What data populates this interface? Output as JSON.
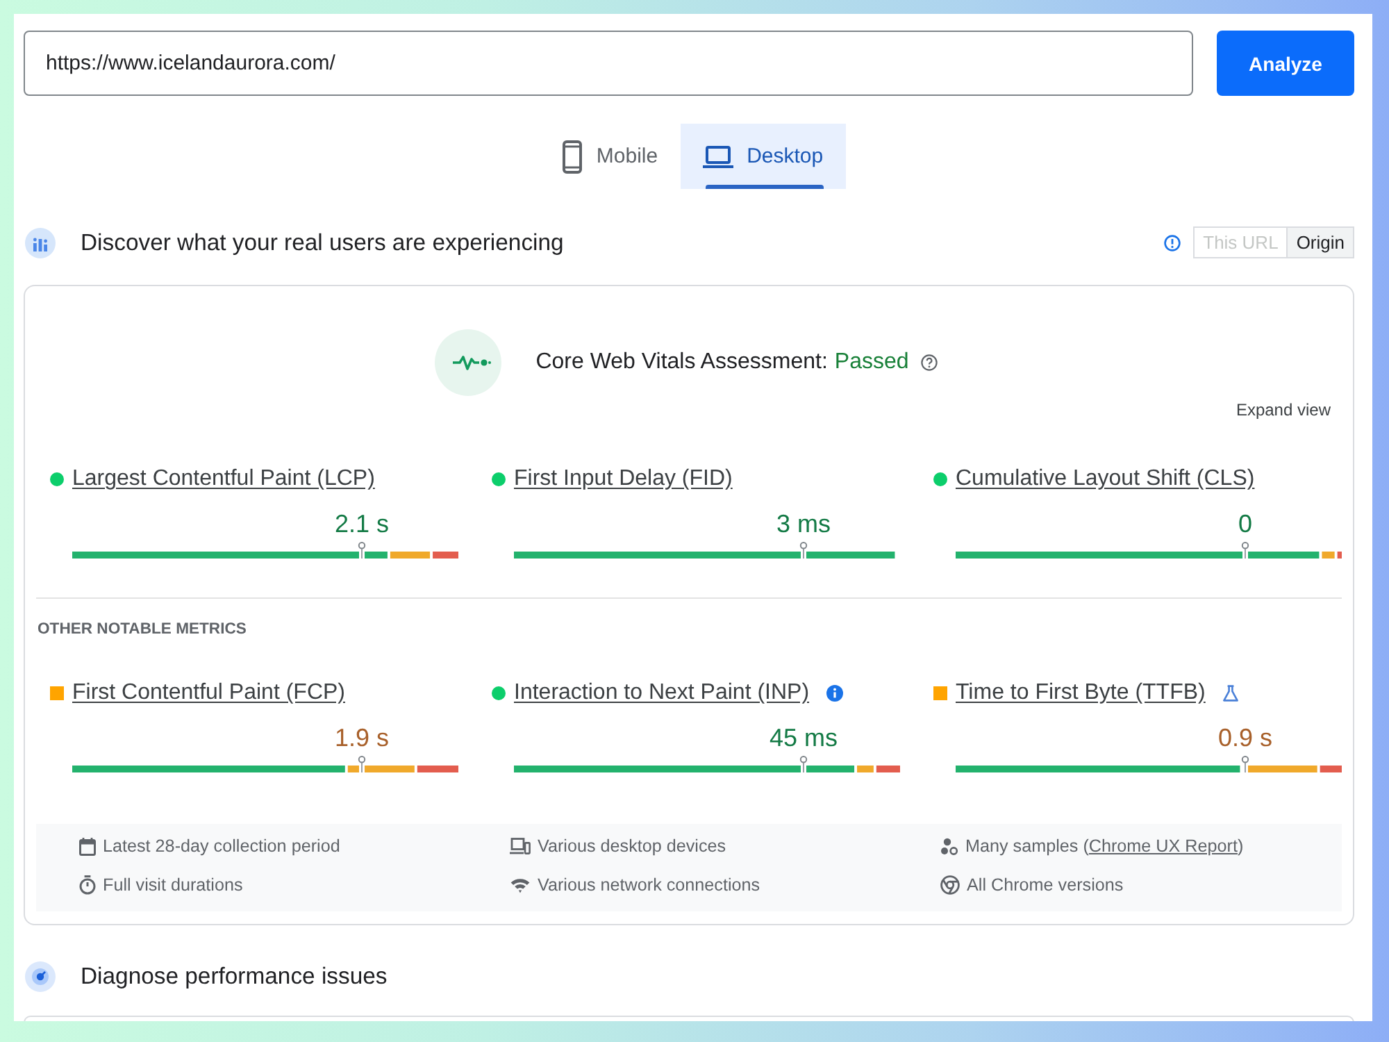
{
  "url_bar": {
    "value": "https://www.icelandaurora.com/",
    "button": "Analyze"
  },
  "device_tabs": [
    {
      "kind": "phone",
      "label": "Mobile",
      "selected": false
    },
    {
      "kind": "laptop",
      "label": "Desktop",
      "selected": true
    }
  ],
  "field_data": {
    "title": "Discover what your real users are experiencing",
    "scope_options": [
      {
        "label": "This URL",
        "selected": false,
        "disabled": true
      },
      {
        "label": "Origin",
        "selected": true,
        "disabled": false
      }
    ]
  },
  "assessment": {
    "label": "Core Web Vitals Assessment:",
    "result": "Passed",
    "passed": true,
    "expand_link": "Expand view"
  },
  "core_metrics": [
    {
      "name": "Largest Contentful Paint (LCP)",
      "value": "2.1 s",
      "kind": "good",
      "color": "#0cce6b",
      "info": false,
      "experimental": false
    },
    {
      "name": "First Input Delay (FID)",
      "value": "3 ms",
      "kind": "good",
      "color": "#0cce6b",
      "info": false,
      "experimental": false
    },
    {
      "name": "Cumulative Layout Shift (CLS)",
      "value": "0",
      "kind": "good",
      "color": "#0cce6b",
      "info": false,
      "experimental": false
    }
  ],
  "other_metrics_heading": "OTHER NOTABLE METRICS",
  "other_metrics": [
    {
      "name": "First Contentful Paint (FCP)",
      "value": "1.9 s",
      "kind": "average",
      "color": "#ffa400",
      "info": false,
      "experimental": false
    },
    {
      "name": "Interaction to Next Paint (INP)",
      "value": "45 ms",
      "kind": "good",
      "color": "#0cce6b",
      "info": true,
      "experimental": false
    },
    {
      "name": "Time to First Byte (TTFB)",
      "value": "0.9 s",
      "kind": "average",
      "color": "#ffa400",
      "info": false,
      "experimental": true
    }
  ],
  "data_notes": [
    {
      "kind": "period",
      "text": "Latest 28-day collection period"
    },
    {
      "kind": "devices",
      "text": "Various desktop devices"
    },
    {
      "kind": "samples",
      "text": "Many samples (",
      "link": "Chrome UX Report",
      "after": ")"
    },
    {
      "kind": "duration",
      "text": "Full visit durations"
    },
    {
      "kind": "network",
      "text": "Various network connections"
    },
    {
      "kind": "versions",
      "text": "All Chrome versions"
    }
  ],
  "diagnostics": {
    "title": "Diagnose performance issues"
  }
}
